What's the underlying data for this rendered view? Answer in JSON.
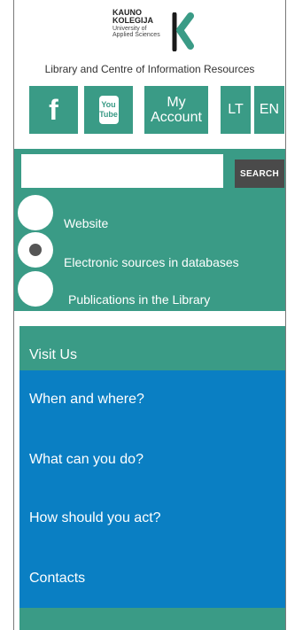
{
  "logo": {
    "line1": "KAUNO",
    "line2": "KOLEGIJA",
    "line3": "University of",
    "line4": "Applied Sciences"
  },
  "header": {
    "library_title": "Library and Centre of Information Resources"
  },
  "toolbar": {
    "facebook_glyph": "f",
    "youtube_line1": "You",
    "youtube_line2": "Tube",
    "account_line1": "My",
    "account_line2": "Account",
    "lang_lt": "LT",
    "lang_en": "EN"
  },
  "search": {
    "placeholder": "",
    "button_label": "SEARCH",
    "options": [
      {
        "label": "Website",
        "selected": false
      },
      {
        "label": "Electronic sources in databases",
        "selected": true
      },
      {
        "label": "Publications in the Library",
        "selected": false
      }
    ]
  },
  "nav": {
    "heading": "Visit Us",
    "items": [
      {
        "label": "When and where?"
      },
      {
        "label": "What can you do?"
      },
      {
        "label": "How should you act?"
      },
      {
        "label": "Contacts"
      }
    ]
  },
  "colors": {
    "accent_green": "#3a9b86",
    "nav_blue": "#0a7fc3",
    "search_button": "#4a4a4a"
  }
}
